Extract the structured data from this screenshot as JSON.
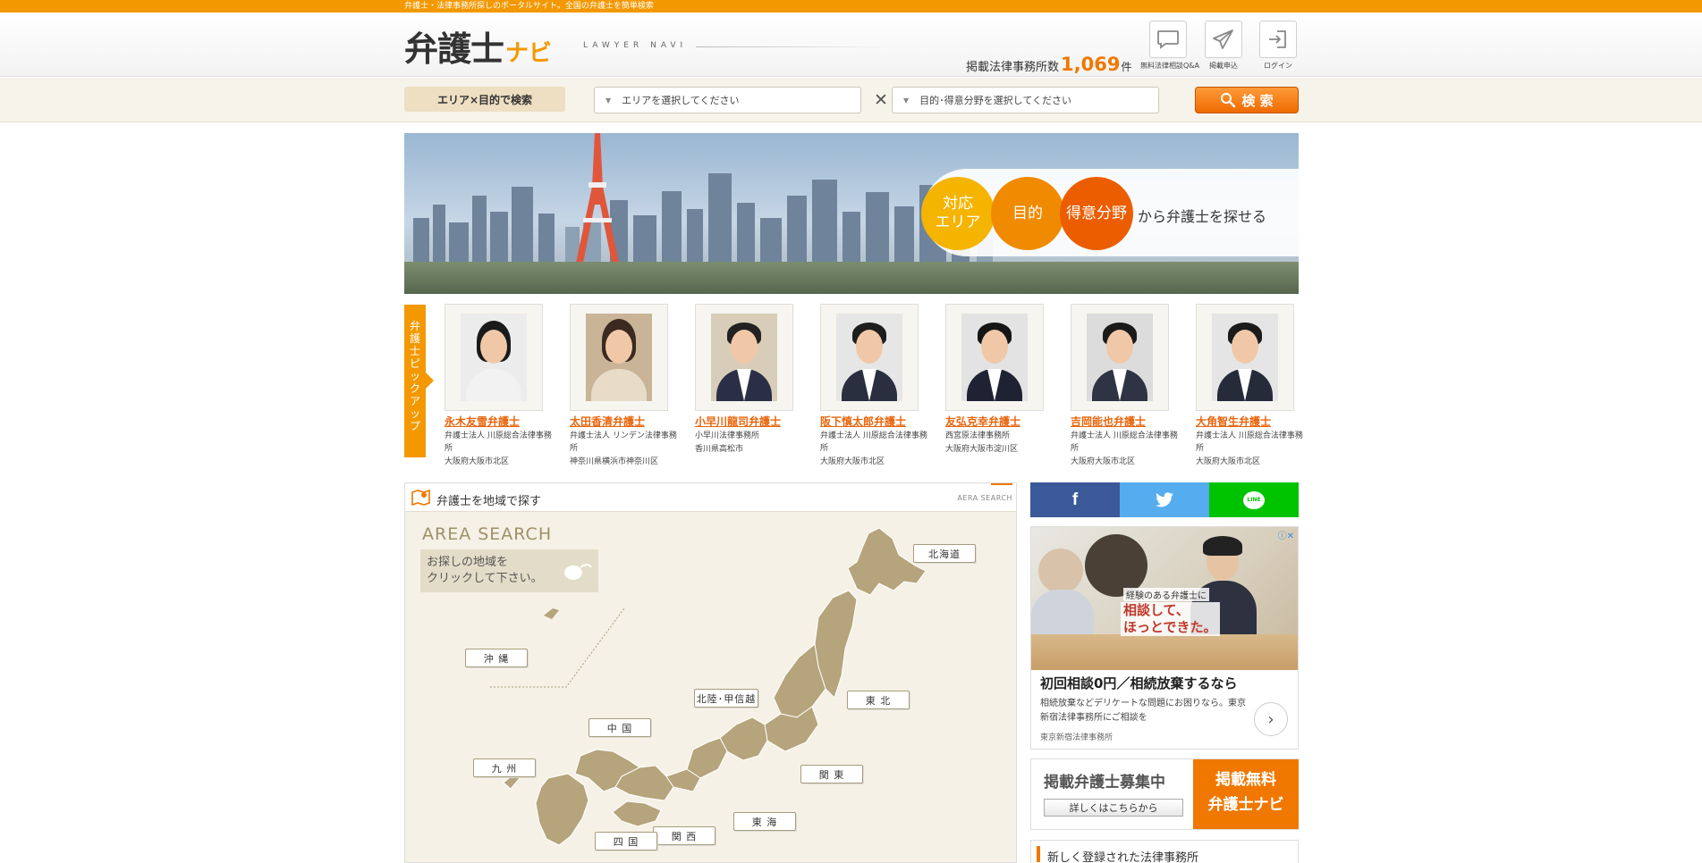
{
  "topbar": {
    "tagline": "弁護士・法律事務所探しのポータルサイト。全国の弁護士を簡単検索"
  },
  "header": {
    "logo_main": "弁護士",
    "logo_sub": "ナビ",
    "logo_en": "LAWYER NAVI",
    "count_label": "掲載法律事務所数",
    "count_value": "1,069",
    "count_unit": "件",
    "icons": [
      {
        "label": "無料法律相談Q&A",
        "icon": "chat-icon"
      },
      {
        "label": "掲載申込",
        "icon": "send-icon"
      },
      {
        "label": "ログイン",
        "icon": "login-icon"
      }
    ]
  },
  "search": {
    "tag": "エリア×目的で検索",
    "area_placeholder": "エリアを選択してください",
    "purpose_placeholder": "目的･得意分野を選択してください",
    "clear": "✕",
    "button": "検 索"
  },
  "hero": {
    "circle1": "対応\nエリア",
    "circle2": "目的",
    "circle3": "得意分野",
    "tail": "から弁護士を探せる",
    "colors": {
      "c1": "#f5b400",
      "c2": "#f08a00",
      "c3": "#ec5d00"
    }
  },
  "pickup": {
    "tab": "弁護士ピックアップ",
    "lawyers": [
      {
        "name": "永木友雪弁護士",
        "firm": "弁護士法人 川原総合法律事務所",
        "location": "大阪府大阪市北区",
        "hair": "#1a1a1a",
        "suit": "#f2f2f2"
      },
      {
        "name": "太田香清弁護士",
        "firm": "弁護士法人 リンデン法律事務所",
        "location": "神奈川県横浜市神奈川区",
        "hair": "#3a2a20",
        "suit": "#e8dcc8"
      },
      {
        "name": "小早川龍司弁護士",
        "firm": "小早川法律事務所",
        "location": "香川県高松市",
        "hair": "#222",
        "suit": "#2b2f45"
      },
      {
        "name": "阪下慎太郎弁護士",
        "firm": "弁護士法人 川原総合法律事務所",
        "location": "大阪府大阪市北区",
        "hair": "#1d1d1d",
        "suit": "#2a2f3f"
      },
      {
        "name": "友弘克幸弁護士",
        "firm": "西宮原法律事務所",
        "location": "大阪府大阪市淀川区",
        "hair": "#151515",
        "suit": "#1e2232"
      },
      {
        "name": "吉岡能也弁護士",
        "firm": "弁護士法人 川原総合法律事務所",
        "location": "大阪府大阪市北区",
        "hair": "#1a1a1a",
        "suit": "#2e3444"
      },
      {
        "name": "大角智生弁護士",
        "firm": "弁護士法人 川原総合法律事務所",
        "location": "大阪府大阪市北区",
        "hair": "#1b1b1b",
        "suit": "#262b3a"
      }
    ]
  },
  "area": {
    "title": "弁護士を地域で探す",
    "en": "AERA SEARCH",
    "big": "AREA SEARCH",
    "hint": "お探しの地域を\nクリックして下さい。",
    "regions": [
      {
        "id": "hokkaido",
        "label": "北海道"
      },
      {
        "id": "tohoku",
        "label": "東 北"
      },
      {
        "id": "hokuriku",
        "label": "北陸･甲信越"
      },
      {
        "id": "kanto",
        "label": "関 東"
      },
      {
        "id": "tokai",
        "label": "東 海"
      },
      {
        "id": "kansai",
        "label": "関 西"
      },
      {
        "id": "chugoku",
        "label": "中 国"
      },
      {
        "id": "shikoku",
        "label": "四 国"
      },
      {
        "id": "kyushu",
        "label": "九 州"
      },
      {
        "id": "okinawa",
        "label": "沖 縄"
      }
    ]
  },
  "share": {
    "facebook": {
      "glyph": "f",
      "color": "#3b5998"
    },
    "twitter": {
      "color": "#55acee"
    },
    "line": {
      "glyph": "LINE",
      "color": "#00c300"
    }
  },
  "ad": {
    "badge_small": "経験のある弁護士に",
    "badge_large": "相談して、\nほっとできた。",
    "title": "初回相談0円／相続放棄するなら",
    "text": "相続放棄などデリケートな問題にお困りなら。東京新宿法律事務所にご相談を",
    "source": "東京新宿法律事務所"
  },
  "recruit": {
    "title": "掲載弁護士募集中",
    "button": "詳しくはこちらから",
    "badge1": "掲載無料",
    "badge2": "弁護士ナビ"
  },
  "new_offices": {
    "title": "新しく登録された法律事務所"
  }
}
